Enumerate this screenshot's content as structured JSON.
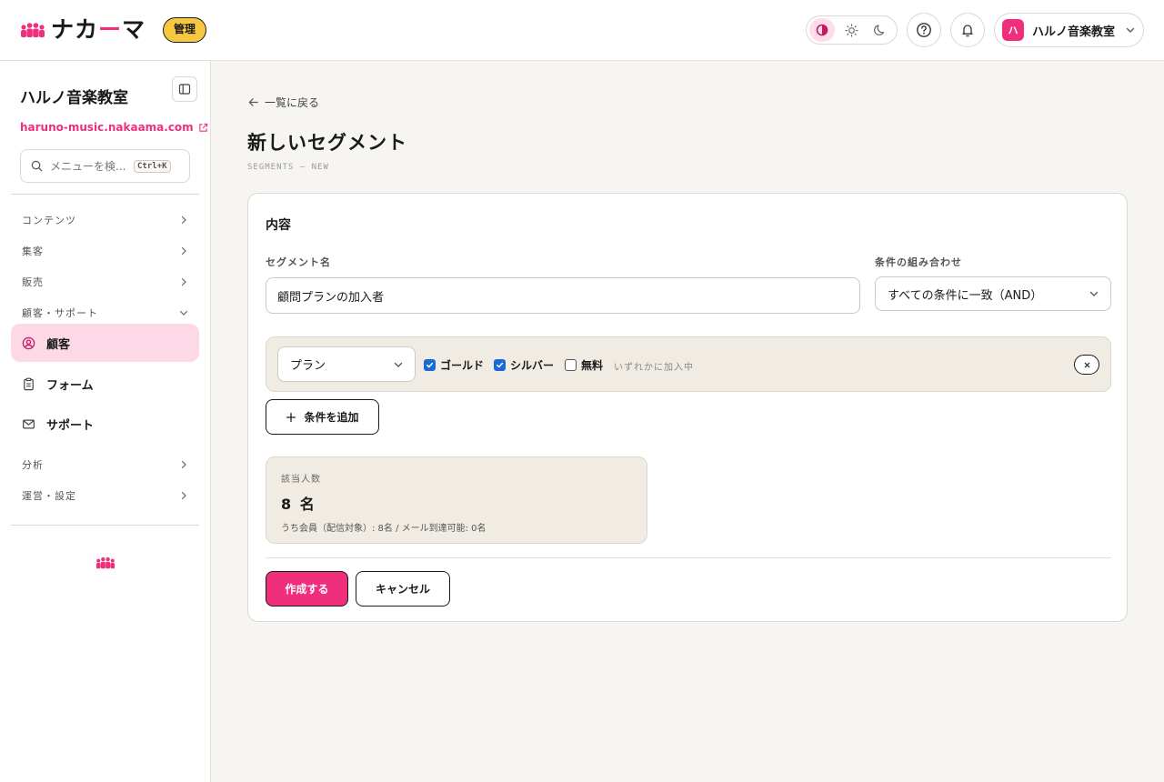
{
  "header": {
    "logo_prefix": "ナカ",
    "logo_accent": "ー",
    "logo_suffix": "マ",
    "admin_badge": "管理",
    "theme_options": [
      "system-theme-icon",
      "sun-icon",
      "moon-icon"
    ],
    "active_theme": "system",
    "account_avatar": "ハ",
    "account_name": "ハルノ音楽教室"
  },
  "sidebar": {
    "site_name": "ハルノ音楽教室",
    "site_url": "haruno-music.nakaama.com",
    "search": {
      "placeholder": "メニューを検...",
      "shortcut": "Ctrl+K"
    },
    "groups": {
      "content": "コンテンツ",
      "marketing": "集客",
      "sales": "販売",
      "customer_support": "顧客・サポート",
      "analytics": "分析",
      "operations": "運営・設定"
    },
    "items": {
      "customers": "顧客",
      "forms": "フォーム",
      "support": "サポート"
    },
    "active_item": "customers"
  },
  "main": {
    "back_link": "一覧に戻る",
    "title": "新しいセグメント",
    "subtitle": "SEGMENTS — NEW",
    "card_title": "内容",
    "segment_name": {
      "label": "セグメント名",
      "value": "顧問プランの加入者"
    },
    "combination": {
      "label": "条件の組み合わせ",
      "selected": "すべての条件に一致（AND）"
    },
    "condition": {
      "field": "プラン",
      "options": [
        {
          "label": "ゴールド",
          "checked": true
        },
        {
          "label": "シルバー",
          "checked": true
        },
        {
          "label": "無料",
          "checked": false
        }
      ],
      "hint": "いずれかに加入中"
    },
    "add_condition": "条件を追加",
    "count": {
      "label": "該当人数",
      "value": "8 名",
      "detail": "うち会員（配信対象）: 8名 / メール到達可能: 0名"
    },
    "submit": "作成する",
    "cancel": "キャンセル"
  },
  "colors": {
    "brand": "#ef2f7c",
    "badge": "#f6c842",
    "active_nav": "#fdd9e8",
    "panel": "#f1ece3"
  }
}
